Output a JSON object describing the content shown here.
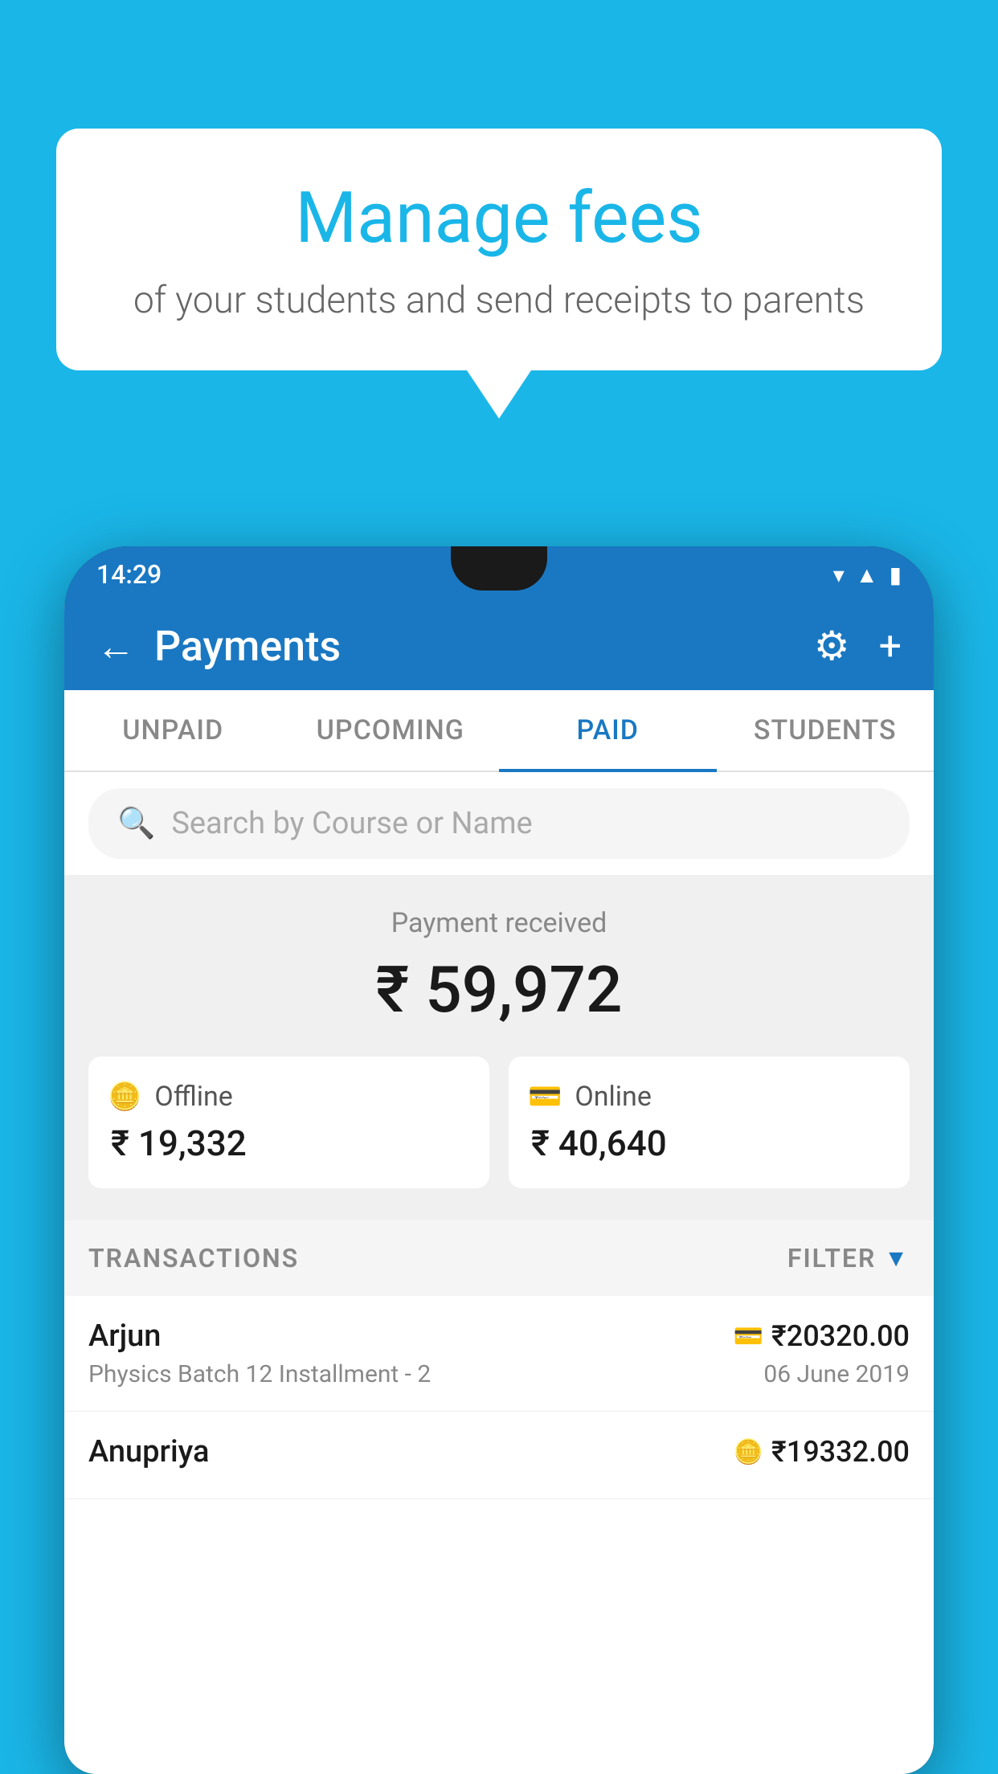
{
  "background_color": "#1ab6e8",
  "speech_bubble": {
    "title": "Manage fees",
    "subtitle": "of your students and send receipts to parents"
  },
  "phone": {
    "time": "14:29",
    "status_icons": [
      "wifi",
      "signal",
      "battery"
    ]
  },
  "header": {
    "title": "Payments",
    "back_label": "←",
    "settings_label": "⚙",
    "add_label": "+"
  },
  "tabs": [
    {
      "label": "UNPAID",
      "active": false
    },
    {
      "label": "UPCOMING",
      "active": false
    },
    {
      "label": "PAID",
      "active": true
    },
    {
      "label": "STUDENTS",
      "active": false
    }
  ],
  "search": {
    "placeholder": "Search by Course or Name"
  },
  "payment_summary": {
    "received_label": "Payment received",
    "total_amount": "₹ 59,972",
    "offline": {
      "label": "Offline",
      "amount": "₹ 19,332"
    },
    "online": {
      "label": "Online",
      "amount": "₹ 40,640"
    }
  },
  "transactions": {
    "header_label": "TRANSACTIONS",
    "filter_label": "FILTER",
    "rows": [
      {
        "name": "Arjun",
        "course": "Physics Batch 12 Installment - 2",
        "amount": "₹20320.00",
        "date": "06 June 2019",
        "payment_type": "card"
      },
      {
        "name": "Anupriya",
        "course": "",
        "amount": "₹19332.00",
        "date": "",
        "payment_type": "cash"
      }
    ]
  }
}
